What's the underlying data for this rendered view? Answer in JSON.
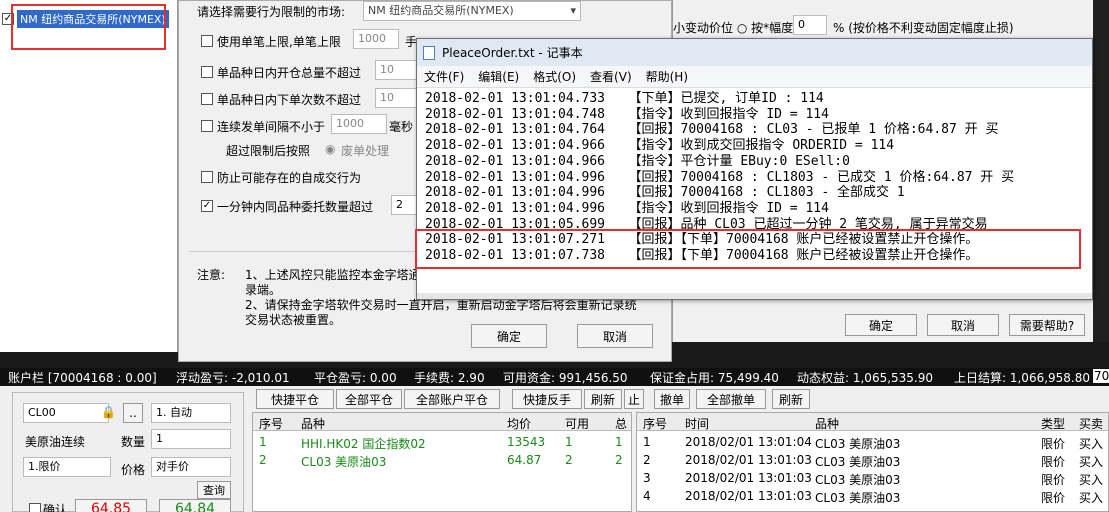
{
  "tree": {
    "selected_market": "NM 纽约商品交易所(NYMEX)"
  },
  "risk": {
    "market_label": "请选择需要行为限制的市场:",
    "market_value": "NM 纽约商品交易所(NYMEX)",
    "opt1_label": "使用单笔上限,单笔上限",
    "opt1_value": "1000",
    "opt1_suffix": "手",
    "opt2_label": "单品种日内开仓总量不超过",
    "opt2_value": "10",
    "opt3_label": "单品种日内下单次数不超过",
    "opt3_value": "10",
    "opt4_label": "连续发单间隔不小于",
    "opt4_value": "1000",
    "opt4_suffix": "毫秒",
    "exceed_label": "超过限制后按照",
    "exceed_opt": "废单处理",
    "opt5_label": "防止可能存在的自成交行为",
    "opt6_label": "一分钟内同品种委托数量超过",
    "opt6_value": "2",
    "note_label": "注意:",
    "note1": "1、上述风控只能监控本金字塔通",
    "note1b": "录端。",
    "note2": "2、请保持金字塔软件交易时一直开启，重新启动金字塔后将会重新记录统",
    "note2b": "交易状态被重置。",
    "ok": "确定",
    "cancel": "取消"
  },
  "rightwin": {
    "top_text": "小变动价位 ○ 按*幅度",
    "top_value": "0",
    "top_suffix": "% (按价格不利变动固定幅度止损)",
    "ok": "确定",
    "cancel": "取消",
    "help": "需要帮助?"
  },
  "notepad": {
    "title": "PleaceOrder.txt - 记事本",
    "menu": [
      "文件(F)",
      "编辑(E)",
      "格式(O)",
      "查看(V)",
      "帮助(H)"
    ],
    "lines": [
      "2018-02-01 13:01:04.733   【下单】已提交, 订单ID : 114",
      "2018-02-01 13:01:04.748   【指令】收到回报指令 ID = 114",
      "2018-02-01 13:01:04.764   【回报】70004168 : CL03 - 已报单 1 价格:64.87 开 买",
      "2018-02-01 13:01:04.966   【指令】收到成交回报指令 ORDERID = 114",
      "2018-02-01 13:01:04.966   【指令】平仓计量 EBuy:0 ESell:0",
      "2018-02-01 13:01:04.996   【回报】70004168 : CL1803 - 已成交 1 价格:64.87 开 买",
      "2018-02-01 13:01:04.996   【回报】70004168 : CL1803 - 全部成交 1",
      "2018-02-01 13:01:04.996   【指令】收到回报指令 ID = 114",
      "2018-02-01 13:01:05.699   【回报】品种 CL03 已超过一分钟 2 笔交易, 属于异常交易",
      "2018-02-01 13:01:07.271   【回报】【下单】70004168 账户已经被设置禁止开仓操作。",
      "2018-02-01 13:01:07.738   【回报】【下单】70004168 账户已经被设置禁止开仓操作。"
    ]
  },
  "status": {
    "account": "账户栏 [70004168 : 0.00]",
    "float": "浮动盈亏: -2,010.01",
    "close": "平仓盈亏: 0.00",
    "fee": "手续费: 2.90",
    "avail": "可用资金: 991,456.50",
    "margin": "保证金占用: 75,499.40",
    "equity": "动态权益: 1,065,535.90",
    "settle": "上日结算: 1,066,958.80",
    "right": "70"
  },
  "order": {
    "code": "CL00",
    "mode": "1. 自动",
    "name": "美原油连续",
    "qty_label": "数量",
    "qty": "1",
    "price_type": "1.限价",
    "price_label": "价格",
    "price": "对手价",
    "query": "查询",
    "confirm": "确认",
    "buy": "64.85",
    "sell": "64.84",
    "dots": ".."
  },
  "toolbar": {
    "b1": "快捷平仓",
    "b2": "全部平仓",
    "b3": "全部账户平仓",
    "b4": "快捷反手",
    "b5": "刷新",
    "b6": "止",
    "b7": "撤单",
    "b8": "全部撤单",
    "b9": "刷新"
  },
  "positions": {
    "headers": [
      "序号",
      "品种",
      "均价",
      "可用",
      "总"
    ],
    "rows": [
      [
        "1",
        "HHI.HK02 国企指数02",
        "13543",
        "1",
        "1"
      ],
      [
        "2",
        "CL03 美原油03",
        "64.87",
        "2",
        "2"
      ]
    ]
  },
  "orders": {
    "headers": [
      "序号",
      "时间",
      "品种",
      "类型",
      "买卖"
    ],
    "rows": [
      [
        "1",
        "2018/02/01 13:01:04",
        "CL03 美原油03",
        "限价",
        "买入"
      ],
      [
        "2",
        "2018/02/01 13:01:03",
        "CL03 美原油03",
        "限价",
        "买入"
      ],
      [
        "3",
        "2018/02/01 13:01:03",
        "CL03 美原油03",
        "限价",
        "买入"
      ],
      [
        "4",
        "2018/02/01 13:01:03",
        "CL03 美原油03",
        "限价",
        "买入"
      ]
    ]
  }
}
